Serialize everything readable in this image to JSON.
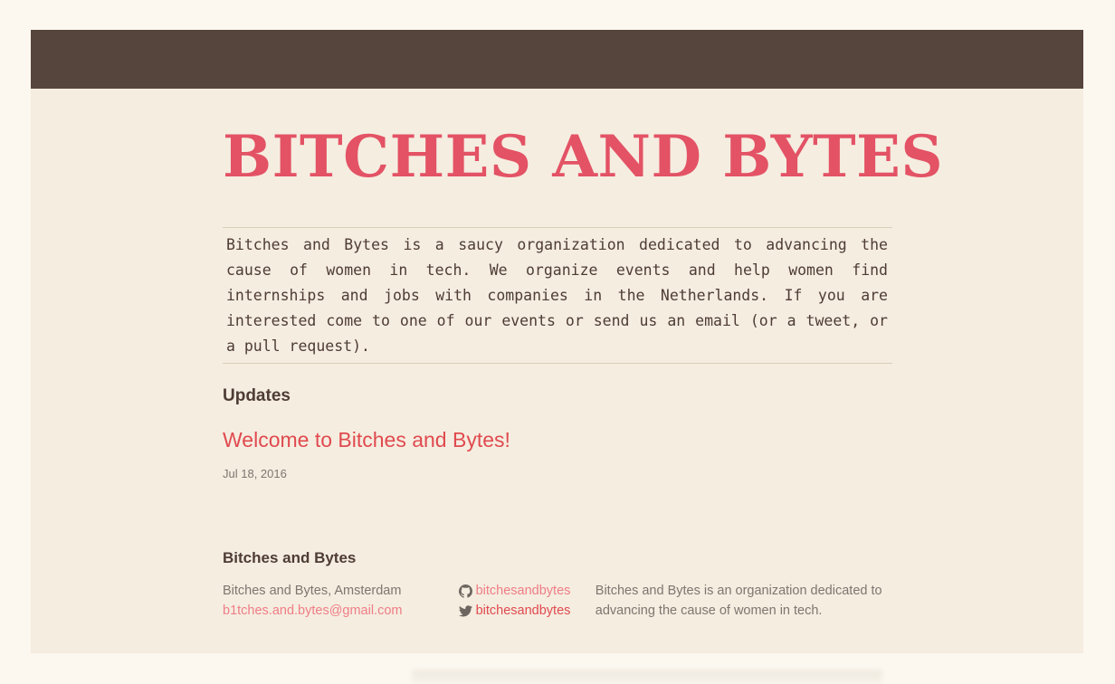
{
  "site": {
    "title": "BITCHES AND BYTES",
    "intro": "Bitches and Bytes is a saucy organization dedicated to advancing the cause of women in tech. We organize events and help women find internships and jobs with companies in the Netherlands. If you are interested come to one of our events or send us an email (or a tweet, or a pull request)."
  },
  "updates": {
    "heading": "Updates",
    "posts": [
      {
        "title": "Welcome to Bitches and Bytes!",
        "date": "Jul 18, 2016"
      }
    ]
  },
  "footer": {
    "heading": "Bitches and Bytes",
    "location": "Bitches and Bytes, Amsterdam",
    "email": "b1tches.and.bytes@gmail.com",
    "github": {
      "icon": "github-icon",
      "handle": "bitchesandbytes"
    },
    "twitter": {
      "icon": "twitter-icon",
      "handle": "bitchesandbytes"
    },
    "description": "Bitches and Bytes is an organization dedicated to advancing the cause of women in tech."
  },
  "colors": {
    "topbar": "#56453d",
    "background": "#f5ede0",
    "accent": "#e35265",
    "text": "#4e3c35"
  }
}
